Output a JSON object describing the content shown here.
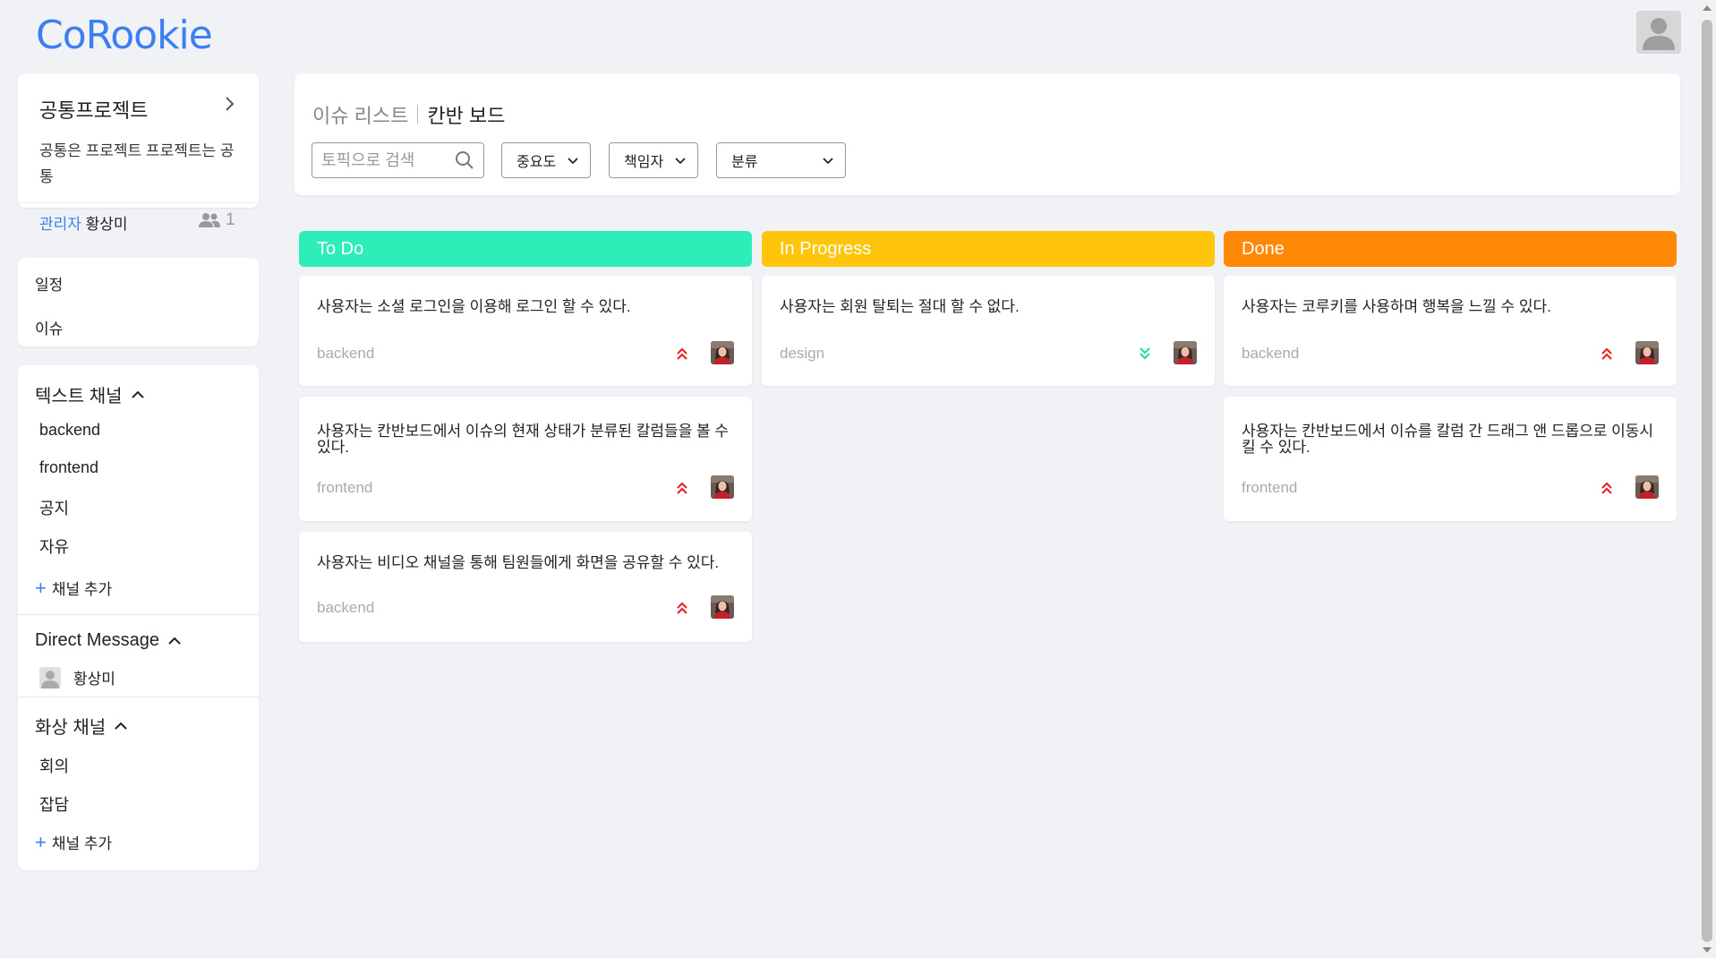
{
  "app": {
    "logo": "CoRookie"
  },
  "colors": {
    "accent": "#3b7ff0",
    "todo": "#2deeb8",
    "in_progress": "#fec50a",
    "done": "#ff8806",
    "priority_high": "#e8262a",
    "priority_low": "#2fd7a5"
  },
  "project": {
    "title": "공통프로젝트",
    "description": "공통은 프로젝트 프로젝트는 공통",
    "admin_label": "관리자",
    "admin_name": "황상미",
    "member_count": "1"
  },
  "nav": {
    "items": [
      {
        "label": "일정"
      },
      {
        "label": "이슈"
      }
    ]
  },
  "text_channels": {
    "title": "텍스트 채널",
    "items": [
      {
        "label": "backend"
      },
      {
        "label": "frontend"
      },
      {
        "label": "공지"
      },
      {
        "label": "자유"
      }
    ],
    "add_label": "채널 추가"
  },
  "direct_message": {
    "title": "Direct Message",
    "items": [
      {
        "label": "황상미"
      }
    ]
  },
  "video_channels": {
    "title": "화상 채널",
    "items": [
      {
        "label": "회의"
      },
      {
        "label": "잡담"
      }
    ],
    "add_label": "채널 추가"
  },
  "header": {
    "breadcrumb": {
      "inactive": "이슈 리스트",
      "active": "칸반 보드"
    },
    "search": {
      "placeholder": "토픽으로 검색",
      "value": ""
    },
    "filters": [
      {
        "label": "중요도"
      },
      {
        "label": "책임자"
      },
      {
        "label": "분류"
      }
    ]
  },
  "columns": [
    {
      "title": "To Do",
      "issues": [
        {
          "title": "사용자는 소셜 로그인을 이용해 로그인 할 수 있다.",
          "tag": "backend",
          "priority": "high",
          "priority_icon": "double-chevron-up-icon"
        },
        {
          "title": "사용자는 칸반보드에서 이슈의 현재 상태가 분류된 칼럼들을 볼 수 있다.",
          "tag": "frontend",
          "priority": "high",
          "priority_icon": "double-chevron-up-icon"
        },
        {
          "title": "사용자는 비디오 채널을 통해 팀원들에게 화면을 공유할 수 있다.",
          "tag": "backend",
          "priority": "high",
          "priority_icon": "double-chevron-up-icon"
        }
      ]
    },
    {
      "title": "In Progress",
      "issues": [
        {
          "title": "사용자는 회원 탈퇴는 절대 할 수 없다.",
          "tag": "design",
          "priority": "low",
          "priority_icon": "double-chevron-down-icon"
        }
      ]
    },
    {
      "title": "Done",
      "issues": [
        {
          "title": "사용자는 코루키를 사용하며 행복을 느낄 수 있다.",
          "tag": "backend",
          "priority": "high",
          "priority_icon": "double-chevron-up-icon"
        },
        {
          "title": "사용자는 칸반보드에서 이슈를 칼럼 간 드래그 앤 드롭으로 이동시킬 수 있다.",
          "tag": "frontend",
          "priority": "high",
          "priority_icon": "double-chevron-up-icon"
        }
      ]
    }
  ]
}
